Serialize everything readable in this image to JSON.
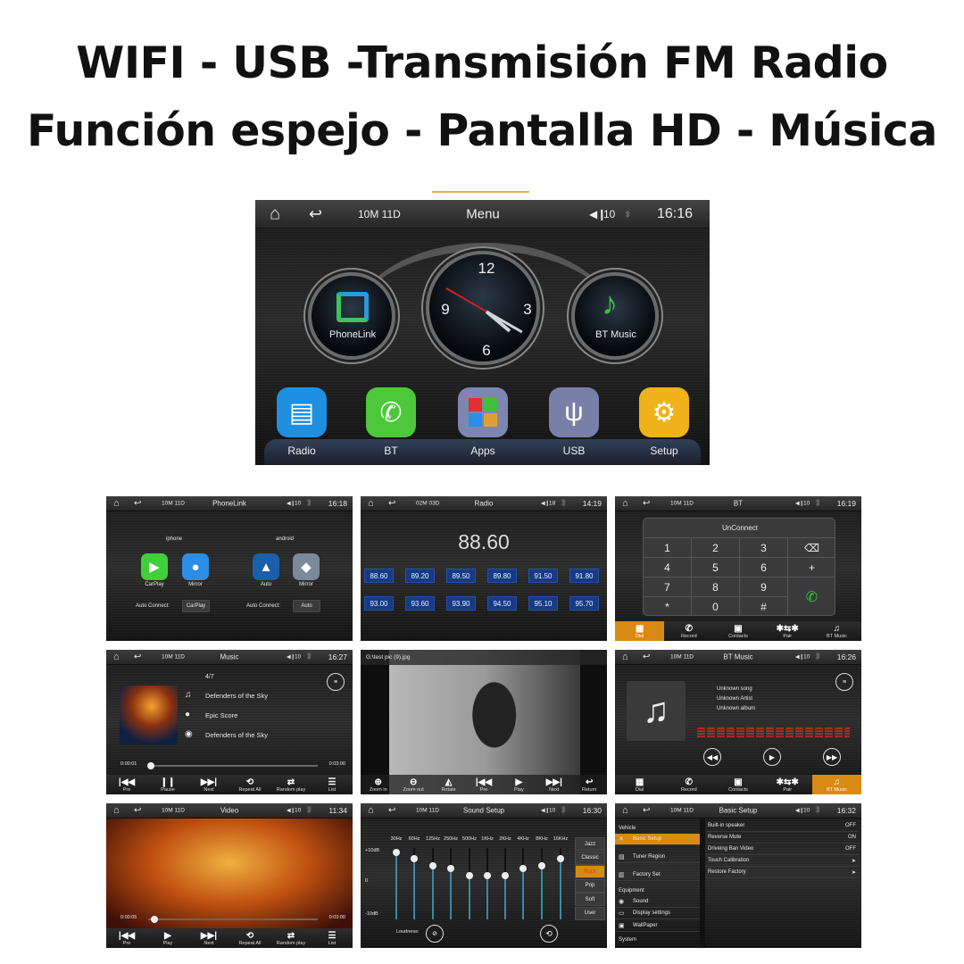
{
  "headline": {
    "line1": "WIFI - USB -Transmisión FM Radio",
    "line2": "Función espejo  - Pantalla HD - Música"
  },
  "main_screen": {
    "status": {
      "date": "10M 11D",
      "title": "Menu",
      "volume": "10",
      "time": "16:16"
    },
    "clock": {
      "numerals": [
        "12",
        "3",
        "6",
        "9"
      ],
      "hour": 4,
      "minute": 20,
      "second": 50
    },
    "widgets": [
      {
        "label": "PhoneLink",
        "icon": "phonelink-icon"
      },
      {
        "label": "BT Music",
        "icon": "bt-music-icon"
      }
    ],
    "apps": [
      {
        "label": "Radio",
        "icon": "radio-icon",
        "color": "#1f8fe0"
      },
      {
        "label": "BT",
        "icon": "phone-icon",
        "color": "#4cc83a"
      },
      {
        "label": "Apps",
        "icon": "apps-grid-icon",
        "color": "#7c86b0"
      },
      {
        "label": "USB",
        "icon": "usb-icon",
        "color": "#7880a8"
      },
      {
        "label": "Setup",
        "icon": "gear-icon",
        "color": "#f0b21a"
      }
    ]
  },
  "screens": {
    "phonelink": {
      "status": {
        "date": "10M 11D",
        "title": "PhoneLink",
        "volume": "10",
        "time": "16:18"
      },
      "groups": [
        {
          "label": "iphone",
          "apps": [
            {
              "label": "CarPlay",
              "color": "#3fcf3a"
            },
            {
              "label": "Mirror",
              "color": "#2a8ee6"
            }
          ]
        },
        {
          "label": "android",
          "apps": [
            {
              "label": "Auto",
              "color": "#1a5fa8"
            },
            {
              "label": "Mirror",
              "color": "#7a8a9a"
            }
          ]
        }
      ],
      "auto_connect": [
        {
          "label": "Auto Connect:",
          "value": "CarPlay"
        },
        {
          "label": "Auto Connect:",
          "value": "Auto"
        }
      ]
    },
    "radio": {
      "status": {
        "date": "02M 03D",
        "title": "Radio",
        "volume": "18",
        "time": "14:19"
      },
      "frequency": "88.60",
      "presets": [
        "88.60",
        "89.20",
        "89.50",
        "89.80",
        "91.50",
        "91.80",
        "93.00",
        "93.60",
        "93.90",
        "94.50",
        "95.10",
        "95.70"
      ]
    },
    "bt": {
      "status": {
        "date": "10M 11D",
        "title": "BT",
        "volume": "10",
        "time": "16:19"
      },
      "connection": "UnConnect",
      "keys": [
        "1",
        "2",
        "3",
        "⌫",
        "4",
        "5",
        "6",
        "+",
        "7",
        "8",
        "9",
        "✆",
        "*",
        "0",
        "#",
        ""
      ],
      "tabs": [
        {
          "label": "Dial",
          "icon": "dialpad-icon"
        },
        {
          "label": "Record",
          "icon": "call-log-icon"
        },
        {
          "label": "Contacts",
          "icon": "contacts-icon"
        },
        {
          "label": "Pair",
          "icon": "bluetooth-pair-icon"
        },
        {
          "label": "BT Music",
          "icon": "music-note-icon"
        }
      ],
      "active_tab": 0
    },
    "music": {
      "status": {
        "date": "10M 11D",
        "title": "Music",
        "volume": "10",
        "time": "16:27"
      },
      "track_index": "4/7",
      "title": "Defenders of the Sky",
      "artist": "Epic Score",
      "album": "Defenders of the Sky",
      "elapsed": "0:00:01",
      "duration": "0:03:00",
      "progress": 0.01,
      "controls": [
        {
          "label": "Pre",
          "icon": "previous-icon"
        },
        {
          "label": "Pause",
          "icon": "pause-icon"
        },
        {
          "label": "Next",
          "icon": "next-icon"
        },
        {
          "label": "Repeat All",
          "icon": "repeat-icon"
        },
        {
          "label": "Random play",
          "icon": "shuffle-icon"
        },
        {
          "label": "List",
          "icon": "list-icon"
        }
      ]
    },
    "photo": {
      "filename": "G:\\test pic (9).jpg",
      "controls": [
        {
          "label": "Zoom in",
          "icon": "zoom-in-icon"
        },
        {
          "label": "Zoom out",
          "icon": "zoom-out-icon"
        },
        {
          "label": "Rotate",
          "icon": "rotate-icon"
        },
        {
          "label": "Pre",
          "icon": "previous-icon"
        },
        {
          "label": "Play",
          "icon": "play-icon"
        },
        {
          "label": "Next",
          "icon": "next-icon"
        },
        {
          "label": "Return",
          "icon": "return-icon"
        }
      ]
    },
    "bt_music": {
      "status": {
        "date": "10M 11D",
        "title": "BT Music",
        "volume": "10",
        "time": "16:26"
      },
      "song": "Unknown song",
      "artist": "Unknown Artist",
      "album": "Unknown album",
      "tabs": [
        {
          "label": "Dial",
          "icon": "dialpad-icon"
        },
        {
          "label": "Record",
          "icon": "call-log-icon"
        },
        {
          "label": "Contacts",
          "icon": "contacts-icon"
        },
        {
          "label": "Pair",
          "icon": "bluetooth-pair-icon"
        },
        {
          "label": "BT Music",
          "icon": "music-note-icon"
        }
      ],
      "active_tab": 4
    },
    "video": {
      "status": {
        "date": "10M 11D",
        "title": "Video",
        "volume": "10",
        "time": "11:34"
      },
      "elapsed": "0:00:05",
      "duration": "0:03:00",
      "progress": 0.03,
      "controls": [
        {
          "label": "Pre",
          "icon": "previous-icon"
        },
        {
          "label": "Play",
          "icon": "play-icon"
        },
        {
          "label": "Next",
          "icon": "next-icon"
        },
        {
          "label": "Repeat All",
          "icon": "repeat-icon"
        },
        {
          "label": "Random play",
          "icon": "shuffle-icon"
        },
        {
          "label": "List",
          "icon": "list-icon"
        }
      ]
    },
    "sound": {
      "status": {
        "date": "10M 11D",
        "title": "Sound Setup",
        "volume": "10",
        "time": "16:30"
      },
      "bands": [
        {
          "f": "30Hz",
          "db": 9
        },
        {
          "f": "60Hz",
          "db": 7
        },
        {
          "f": "125Hz",
          "db": 5
        },
        {
          "f": "250Hz",
          "db": 4
        },
        {
          "f": "500Hz",
          "db": 2
        },
        {
          "f": "1KHz",
          "db": 2
        },
        {
          "f": "2KHz",
          "db": 2
        },
        {
          "f": "4KHz",
          "db": 4
        },
        {
          "f": "8KHz",
          "db": 5
        },
        {
          "f": "16KHz",
          "db": 7
        }
      ],
      "scale": [
        "+10dB",
        "0",
        "-10dB"
      ],
      "presets": [
        "Jazz",
        "Classic",
        "Rock",
        "Pop",
        "Soft",
        "User"
      ],
      "active_preset": 2,
      "loudness_label": "Loudness:"
    },
    "basic": {
      "status": {
        "date": "10M 11D",
        "title": "Basic Setup",
        "volume": "10",
        "time": "16:32"
      },
      "sidebar": [
        {
          "label": "Vehicle",
          "header": true
        },
        {
          "label": "Basic Setup",
          "icon": "tools-icon",
          "active": true
        },
        {
          "label": "Tuner Region",
          "icon": "radio-icon"
        },
        {
          "label": "Factory Set",
          "icon": "factory-icon"
        },
        {
          "label": "Equipment",
          "header": true
        },
        {
          "label": "Sound",
          "icon": "sound-icon"
        },
        {
          "label": "Display settings",
          "icon": "display-icon"
        },
        {
          "label": "WallPaper",
          "icon": "wallpaper-icon"
        },
        {
          "label": "System",
          "header": true
        }
      ],
      "settings": [
        {
          "label": "Built-in speaker",
          "value": "OFF"
        },
        {
          "label": "Reverse Mute",
          "value": "ON"
        },
        {
          "label": "Driveing Ban Video",
          "value": "OFF"
        },
        {
          "label": "Touch Calibration",
          "value": "➤"
        },
        {
          "label": "Restore Factory",
          "value": "➤"
        }
      ]
    }
  }
}
